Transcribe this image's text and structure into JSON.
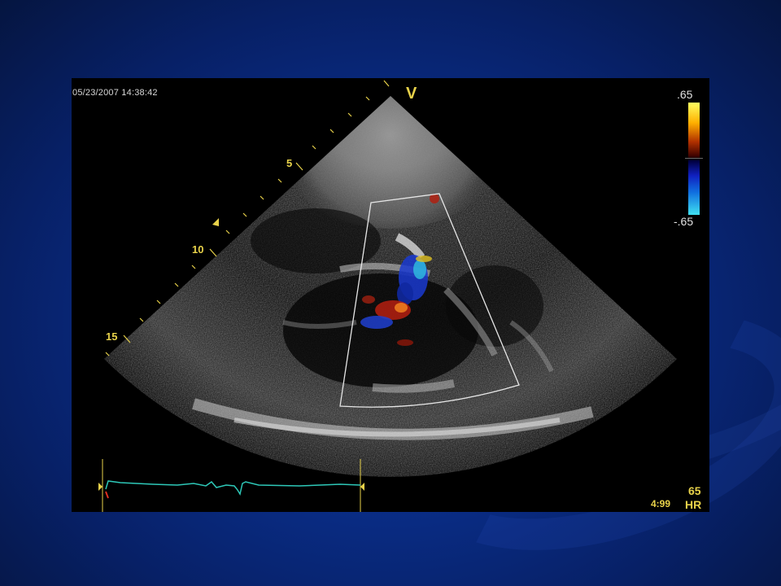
{
  "echo": {
    "timestamp": "05/23/2007 14:38:42",
    "probe_marker": "V",
    "depth_labels": [
      "5",
      "10",
      "15"
    ],
    "color_scale": {
      "top": ".65",
      "bottom": "-.65"
    },
    "heart_rate": {
      "value": "65",
      "label": "HR"
    },
    "frame_counter": "4:99"
  },
  "colors": {
    "background": "#0a2f8c",
    "annotation": "#e8d24a",
    "ecg_trace": "#2ec8b8",
    "roi_box": "#e6e6e6"
  }
}
